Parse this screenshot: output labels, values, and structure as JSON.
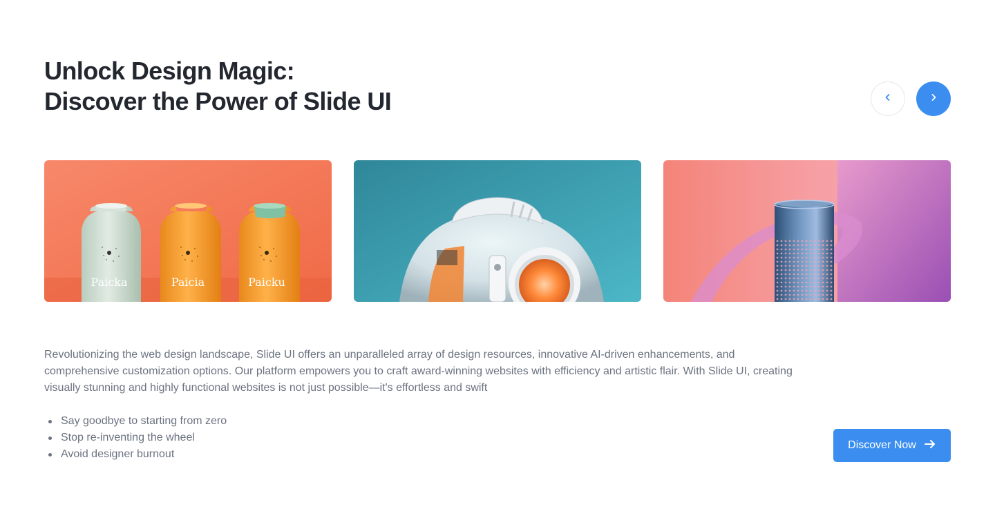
{
  "hero": {
    "title_line1": "Unlock Design Magic:",
    "title_line2": "Discover the Power of Slide UI"
  },
  "carousel": {
    "prev_icon": "chevron-left-icon",
    "next_icon": "chevron-right-icon",
    "slides": [
      {
        "subject": "packaging bottles",
        "labels": [
          "Paicka",
          "Paicia",
          "Paicku"
        ],
        "background": "#f67c5c"
      },
      {
        "subject": "spherical robot device",
        "background": "#3fa3b3"
      },
      {
        "subject": "smart speaker",
        "background": "#f7908a"
      }
    ]
  },
  "description": "Revolutionizing the web design landscape, Slide UI offers an unparalleled array of design resources, innovative AI-driven enhancements, and comprehensive customization options. Our platform empowers you to craft award-winning websites with efficiency and artistic flair. With Slide UI, creating visually stunning and highly functional websites is not just possible—it's effortless and swift",
  "features": [
    "Say goodbye to starting from zero",
    "Stop re-inventing the wheel",
    "Avoid designer burnout"
  ],
  "cta": {
    "label": "Discover Now",
    "icon": "arrow-right-icon"
  },
  "colors": {
    "accent": "#3b8ef0",
    "heading": "#23272f",
    "body_text": "#6b7280"
  }
}
